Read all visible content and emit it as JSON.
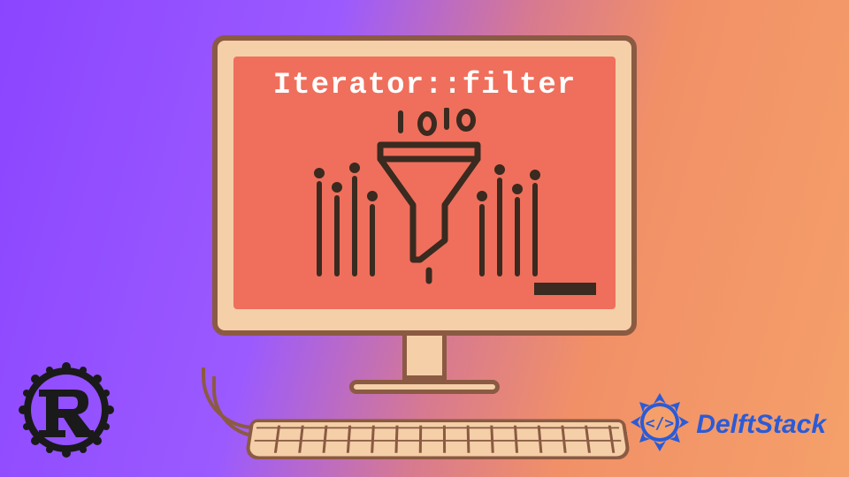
{
  "screen": {
    "title": "Iterator::filter"
  },
  "logos": {
    "rust_name": "rust-logo",
    "delft_name": "DelftStack"
  },
  "colors": {
    "monitor_fill": "#f4cfa8",
    "monitor_stroke": "#8b5a42",
    "screen_bg": "#ef6f5c",
    "delft_blue": "#2b5bd6"
  }
}
